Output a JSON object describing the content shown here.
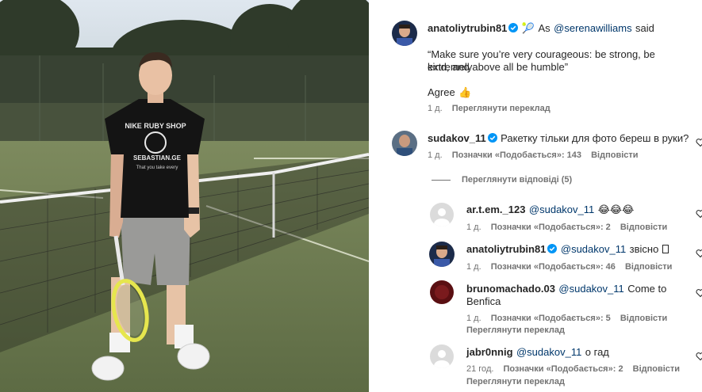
{
  "post": {
    "author": "anatoliytrubin81",
    "emoji_racket": "🎾",
    "intro_prefix": "As",
    "intro_mention": "@serenawilliams",
    "intro_suffix": "said",
    "quote_line1": "“Make sure you’re very courageous: be strong, be extremely",
    "quote_line2": "kind, and above all be humble”",
    "agree": "Agree",
    "agree_emoji": "👍",
    "time": "1 д.",
    "translate": "Переглянути переклад"
  },
  "comments": [
    {
      "user": "sudakov_11",
      "text": "Ракетку тільки для фото береш в руки?",
      "time": "1 д.",
      "likes": "Позначки «Подобається»: 143",
      "reply": "Відповісти",
      "verified": true
    }
  ],
  "view_replies": "Переглянути відповіді (5)",
  "replies": [
    {
      "user": "ar.t.em._123",
      "mention": "@sudakov_11",
      "text": "😂😂😂",
      "time": "1 д.",
      "likes": "Позначки «Подобається»: 2",
      "reply": "Відповісти"
    },
    {
      "user": "anatoliytrubin81",
      "mention": "@sudakov_11",
      "text": "звісно",
      "time": "1 д.",
      "likes": "Позначки «Подобається»: 46",
      "reply": "Відповісти",
      "verified": true
    },
    {
      "user": "brunomachado.03",
      "mention": "@sudakov_11",
      "text_line1": "Come to",
      "text_line2": "Benfica",
      "time": "1 д.",
      "likes": "Позначки «Подобається»: 5",
      "reply": "Відповісти",
      "translate": "Переглянути переклад"
    },
    {
      "user": "jabr0nnig",
      "mention": "@sudakov_11",
      "text": "о гад",
      "time": "21 год.",
      "likes": "Позначки «Подобається»: 2",
      "reply": "Відповісти",
      "translate": "Переглянути переклад"
    }
  ],
  "photo": {
    "shirt_text_line1": "NIKE RUBY SHOP",
    "shirt_text_line2": "SEBASTIAN.GE",
    "shirt_text_line3": "That you take every"
  },
  "colors": {
    "verified": "#0095f6",
    "mention": "#00376b",
    "meta": "#737373",
    "court": "#6b7a52"
  }
}
